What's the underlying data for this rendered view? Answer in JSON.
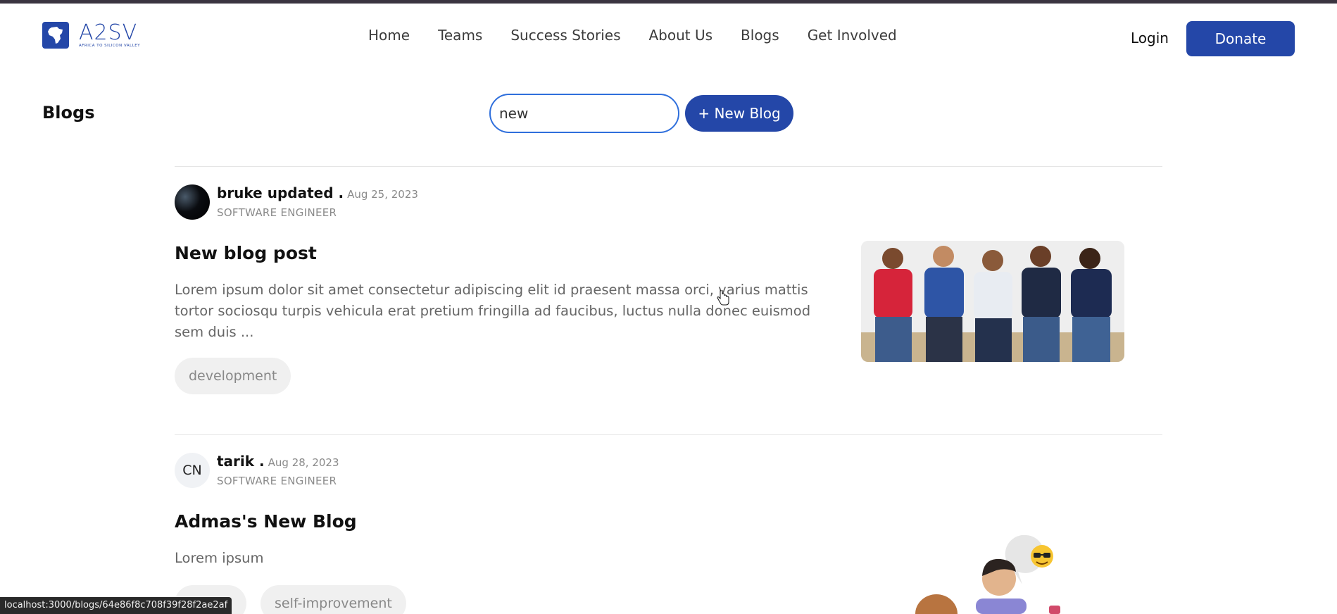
{
  "header": {
    "logo_text": "A2SV",
    "logo_sub": "AFRICA TO SILICON VALLEY",
    "nav": [
      {
        "label": "Home"
      },
      {
        "label": "Teams"
      },
      {
        "label": "Success Stories"
      },
      {
        "label": "About Us"
      },
      {
        "label": "Blogs"
      },
      {
        "label": "Get Involved"
      }
    ],
    "login_label": "Login",
    "donate_label": "Donate"
  },
  "toolbar": {
    "page_title": "Blogs",
    "search_value": "new",
    "new_blog_label": "+ New Blog"
  },
  "posts": [
    {
      "author": "bruke updated .",
      "date": "Aug 25, 2023",
      "role": "SOFTWARE ENGINEER",
      "title": "New blog post",
      "excerpt": "Lorem ipsum dolor sit amet consectetur adipiscing elit id praesent massa orci, varius mattis tortor sociosqu turpis vehicula erat pretium fringilla ad faucibus, luctus nulla donec euismod sem duis ...",
      "tags": [
        "development"
      ]
    },
    {
      "author": "tarik .",
      "date": "Aug 28, 2023",
      "avatar_initials": "CN",
      "role": "SOFTWARE ENGINEER",
      "title": "Admas's New Blog",
      "excerpt": "Lorem ipsum",
      "tags": [
        "",
        "self-improvement"
      ]
    }
  ],
  "statusbar": {
    "url": "localhost:3000/blogs/64e86f8c708f39f28f2ae2af"
  },
  "colors": {
    "brand": "#2447a8",
    "search_border": "#2f6fdc"
  }
}
